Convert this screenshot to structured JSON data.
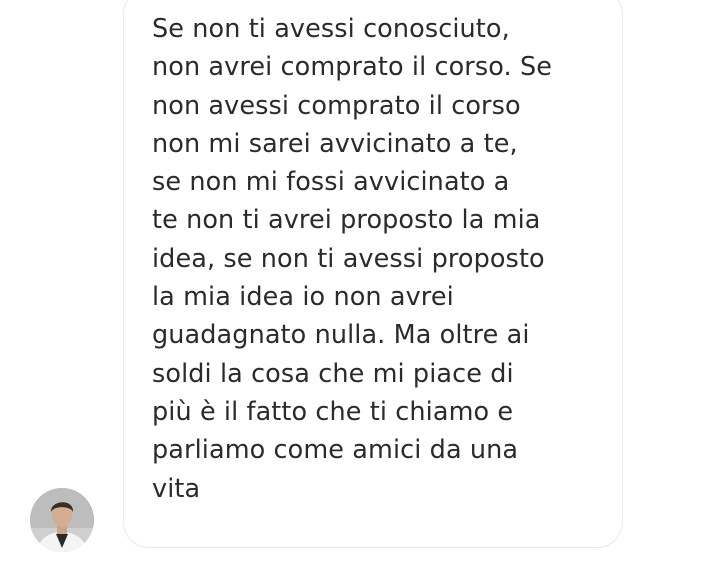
{
  "chat": {
    "message": {
      "lines": [
        "Se non ti avessi conosciuto,",
        "non avrei comprato il corso. Se",
        "non avessi comprato il corso",
        "non mi sarei avvicinato a te,",
        "se non mi fossi avvicinato a",
        "te non ti avrei proposto la mia",
        "idea, se non ti avessi proposto",
        "la mia idea io non avrei",
        "guadagnato nulla. Ma oltre ai",
        "soldi la cosa che mi piace di",
        "più è il fatto che ti chiamo e",
        "parliamo come amici da una",
        "vita"
      ]
    },
    "sender": {
      "avatar_icon": "user-photo-avatar"
    },
    "colors": {
      "text": "#2b2b2b",
      "bubble_border": "#e9e9e9",
      "background": "#ffffff"
    }
  }
}
